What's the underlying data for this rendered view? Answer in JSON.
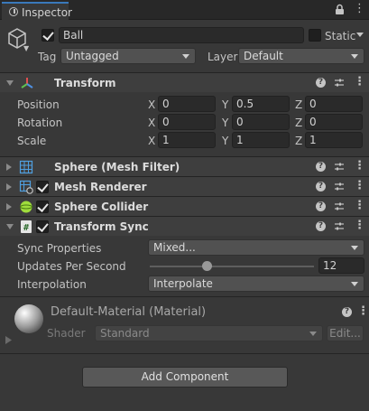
{
  "tab": {
    "title": "Inspector"
  },
  "object": {
    "active": true,
    "name": "Ball",
    "static_label": "Static",
    "tag_label": "Tag",
    "tag_value": "Untagged",
    "layer_label": "Layer",
    "layer_value": "Default"
  },
  "transform": {
    "title": "Transform",
    "position": {
      "label": "Position",
      "x": "0",
      "y": "0.5",
      "z": "0"
    },
    "rotation": {
      "label": "Rotation",
      "x": "0",
      "y": "0",
      "z": "0"
    },
    "scale": {
      "label": "Scale",
      "x": "1",
      "y": "1",
      "z": "1"
    },
    "axis_x": "X",
    "axis_y": "Y",
    "axis_z": "Z"
  },
  "components": [
    {
      "title": "Sphere (Mesh Filter)"
    },
    {
      "title": "Mesh Renderer",
      "enabled": true
    },
    {
      "title": "Sphere Collider",
      "enabled": true
    },
    {
      "title": "Transform Sync",
      "enabled": true
    }
  ],
  "transform_sync": {
    "sync_properties_label": "Sync Properties",
    "sync_properties_value": "Mixed...",
    "updates_label": "Updates Per Second",
    "updates_value": "12",
    "updates_fraction": 0.35,
    "interpolation_label": "Interpolation",
    "interpolation_value": "Interpolate"
  },
  "material": {
    "title": "Default-Material (Material)",
    "shader_label": "Shader",
    "shader_value": "Standard",
    "edit_label": "Edit..."
  },
  "add_component_label": "Add Component",
  "icons": {
    "tab": "info-icon",
    "lock": "lock-icon",
    "menu": "kebab-menu-icon",
    "gameobject": "cube-icon",
    "help": "help-icon",
    "preset": "preset-sliders-icon"
  },
  "colors": {
    "background": "#383838",
    "header": "#3e3e3e",
    "field": "#2a2a2a",
    "accent": "#3a79bb"
  }
}
